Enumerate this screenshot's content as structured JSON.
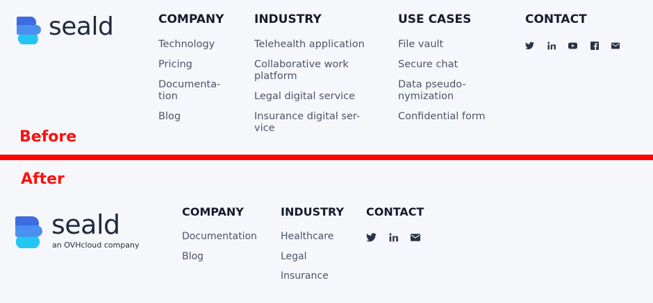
{
  "before": {
    "label": "Before",
    "brand": {
      "wordmark": "seald"
    },
    "columns": [
      {
        "heading": "COMPANY",
        "links": [
          "Technology",
          "Pricing",
          "Documenta-\ntion",
          "Blog"
        ]
      },
      {
        "heading": "INDUSTRY",
        "links": [
          "Telehealth application",
          "Collaborative work\nplatform",
          "Legal digital service",
          "Insurance digital ser-\nvice"
        ]
      },
      {
        "heading": "USE CASES",
        "links": [
          "File vault",
          "Secure chat",
          "Data pseudo-\nnymization",
          "Confidential form"
        ]
      },
      {
        "heading": "CONTACT",
        "icons": [
          "twitter-icon",
          "linkedin-icon",
          "youtube-icon",
          "facebook-icon",
          "email-icon"
        ]
      }
    ]
  },
  "after": {
    "label": "After",
    "brand": {
      "wordmark": "seald",
      "tagline": "an OVHcloud company"
    },
    "columns": [
      {
        "heading": "COMPANY",
        "links": [
          "Documentation",
          "Blog"
        ]
      },
      {
        "heading": "INDUSTRY",
        "links": [
          "Healthcare",
          "Legal",
          "Insurance"
        ]
      },
      {
        "heading": "CONTACT",
        "icons": [
          "twitter-icon",
          "linkedin-icon",
          "email-icon"
        ]
      }
    ]
  },
  "colors": {
    "divider": "#ff0000",
    "marker": "#ff1010",
    "logo_light": "#23c6f2",
    "logo_dark": "#3d6be0"
  }
}
